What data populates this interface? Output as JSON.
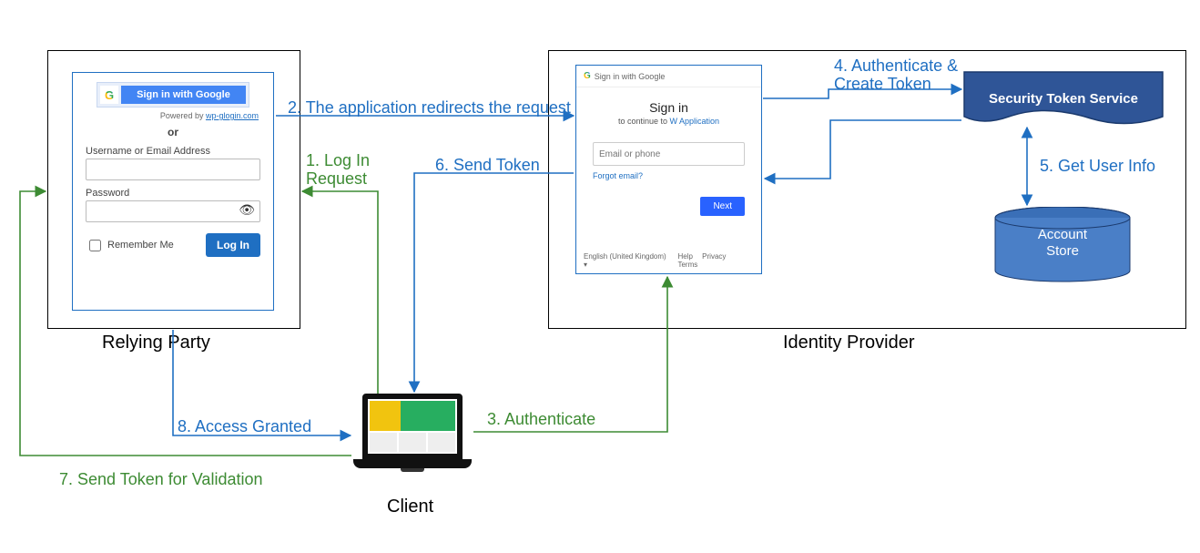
{
  "actors": {
    "relying_party": "Relying Party",
    "identity_provider": "Identity Provider",
    "client": "Client",
    "sts": "Security Token Service",
    "account_store_l1": "Account",
    "account_store_l2": "Store"
  },
  "steps": {
    "s1_l1": "1. Log In",
    "s1_l2": "Request",
    "s2": "2. The application redirects the request",
    "s3": "3. Authenticate",
    "s4_l1": "4. Authenticate &",
    "s4_l2": "Create Token",
    "s5": "5. Get User Info",
    "s6": "6. Send Token",
    "s7": "7. Send Token for Validation",
    "s8": "8. Access Granted"
  },
  "rp_form": {
    "google_button": "Sign in with Google",
    "powered_by": "Powered by",
    "powered_link": "wp-glogin.com",
    "or": "or",
    "user_label": "Username or Email Address",
    "pwd_label": "Password",
    "remember": "Remember Me",
    "login": "Log In"
  },
  "idp_form": {
    "header": "Sign in with Google",
    "signin": "Sign in",
    "continue_prefix": "to continue to",
    "continue_app": "W Application",
    "input_placeholder": "Email or phone",
    "forgot": "Forgot email?",
    "next": "Next",
    "lang": "English (United Kingdom)",
    "help": "Help",
    "privacy": "Privacy",
    "terms": "Terms"
  }
}
